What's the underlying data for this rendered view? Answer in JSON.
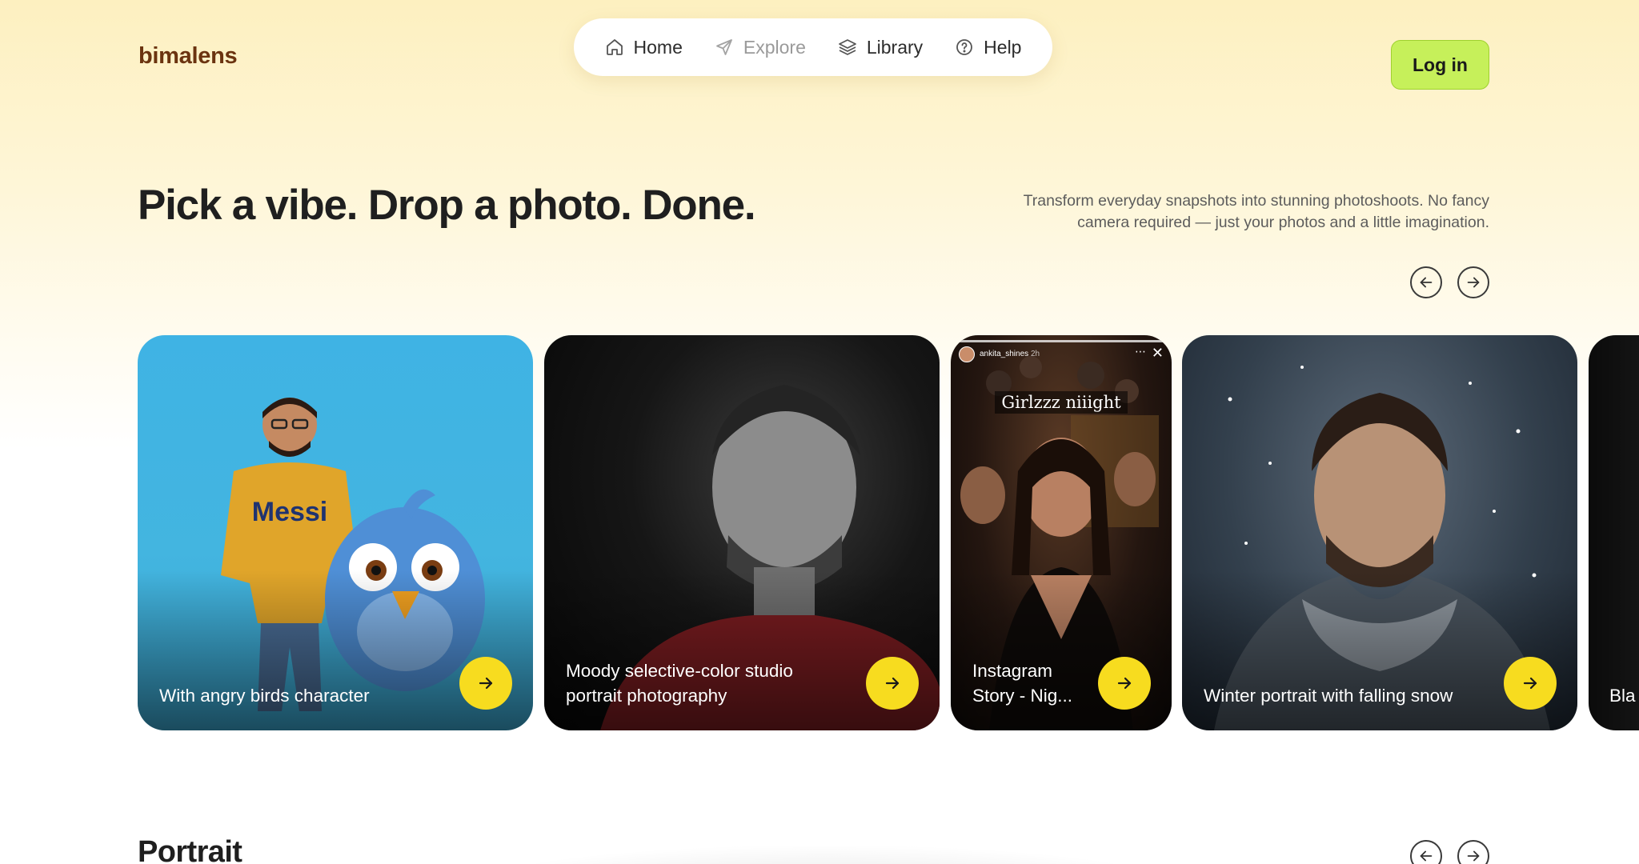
{
  "app": {
    "logo_text": "bimalens"
  },
  "nav": {
    "items": [
      {
        "label": "Home",
        "icon": "home-icon"
      },
      {
        "label": "Explore",
        "icon": "send-icon"
      },
      {
        "label": "Library",
        "icon": "layers-icon"
      },
      {
        "label": "Help",
        "icon": "help-circle-icon"
      }
    ]
  },
  "header": {
    "login_label": "Log in"
  },
  "hero": {
    "title": "Pick a vibe. Drop a photo. Done.",
    "subtitle_line1": "Transform everyday snapshots into stunning photoshoots. No fancy",
    "subtitle_line2": "camera required — just your photos and a little imagination."
  },
  "cards": [
    {
      "label": "With angry birds character",
      "sweater_text": "Messi"
    },
    {
      "label": "Moody selective-color studio portrait photography"
    },
    {
      "label": "Instagram Story - Nig...",
      "story_user": "ankita_shines",
      "story_time": "2h",
      "story_caption": "Girlzzz niiight"
    },
    {
      "label": "Winter portrait with falling snow"
    },
    {
      "label": "Bla"
    }
  ],
  "section": {
    "title": "Portrait"
  },
  "colors": {
    "accent_yellow": "#f7dc1f",
    "login_green": "#c6f05a",
    "logo_brown": "#6b3410"
  }
}
